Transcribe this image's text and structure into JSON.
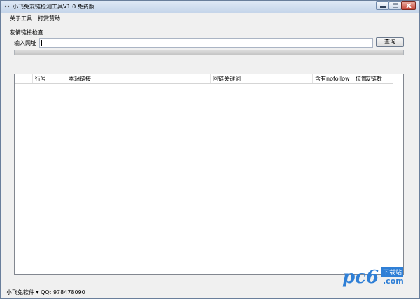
{
  "window": {
    "title": "小飞兔友链检测工具V1.0 免费版"
  },
  "menu": {
    "items": [
      {
        "label": "关于工具"
      },
      {
        "label": "打赏赞助"
      }
    ]
  },
  "form": {
    "group_label": "友情链接检查",
    "url_label": "输入网址",
    "url_value": "",
    "query_button": "查询",
    "progress": 0
  },
  "table": {
    "columns": [
      "行号",
      "本站链接",
      "回链关键词",
      "含有nofollow",
      "位置",
      "友链数"
    ],
    "rows": []
  },
  "status": {
    "label": "小飞兔软件",
    "qq": "QQ: 978478090"
  },
  "watermark": {
    "logo": "pc6",
    "site_cn": "下载站",
    "domain": ".com"
  },
  "colors": {
    "progress_fill": "#37b34a",
    "watermark": "#2f7fd6"
  }
}
